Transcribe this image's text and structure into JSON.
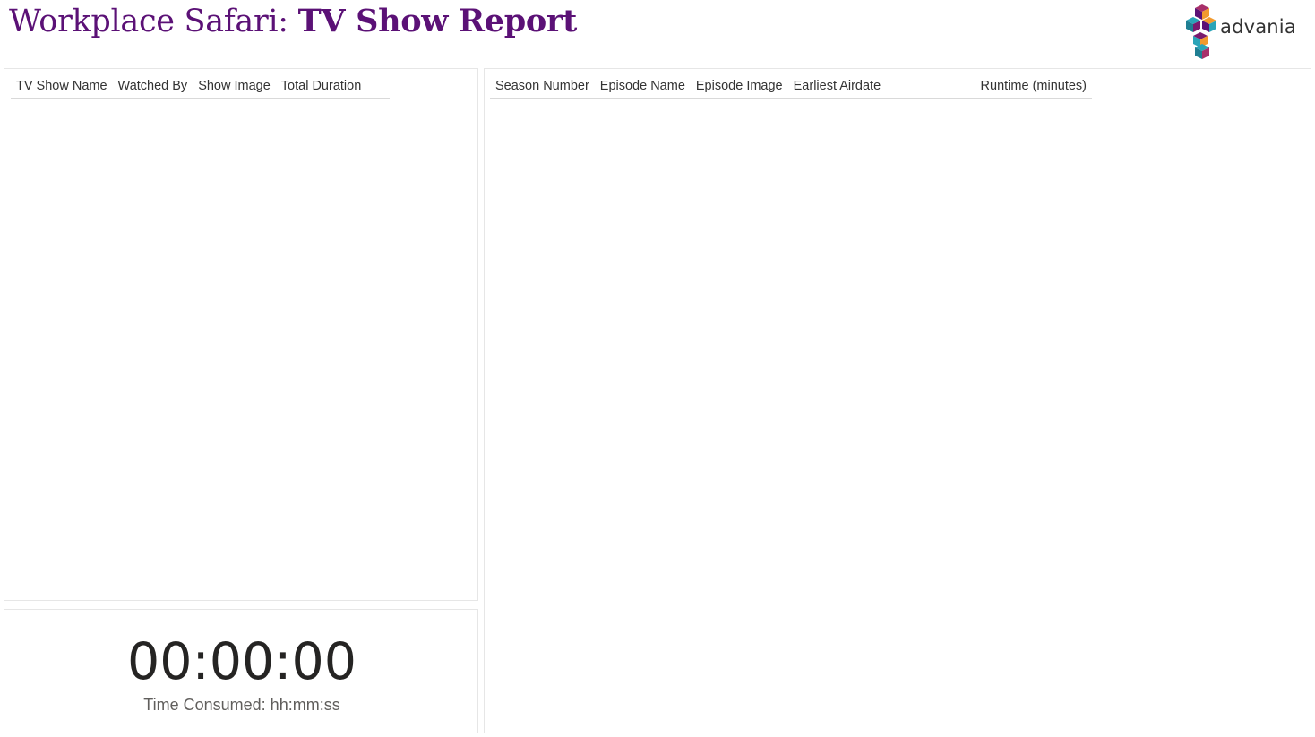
{
  "header": {
    "title_prefix": "Workplace Safari: ",
    "title_bold": "TV Show Report",
    "logo_text": "advania"
  },
  "shows_table": {
    "columns": [
      "TV Show Name",
      "Watched By",
      "Show Image",
      "Total Duration"
    ]
  },
  "episodes_table": {
    "columns": [
      "Season Number",
      "Episode Name",
      "Episode Image",
      "Earliest Airdate",
      "Runtime (minutes)"
    ]
  },
  "card": {
    "value": "00:00:00",
    "label": "Time Consumed: hh:mm:ss"
  },
  "colors": {
    "title": "#5b1176",
    "logo_purple": "#7a1a6e",
    "logo_orange": "#f29a2e",
    "logo_teal": "#2aa4b8"
  }
}
